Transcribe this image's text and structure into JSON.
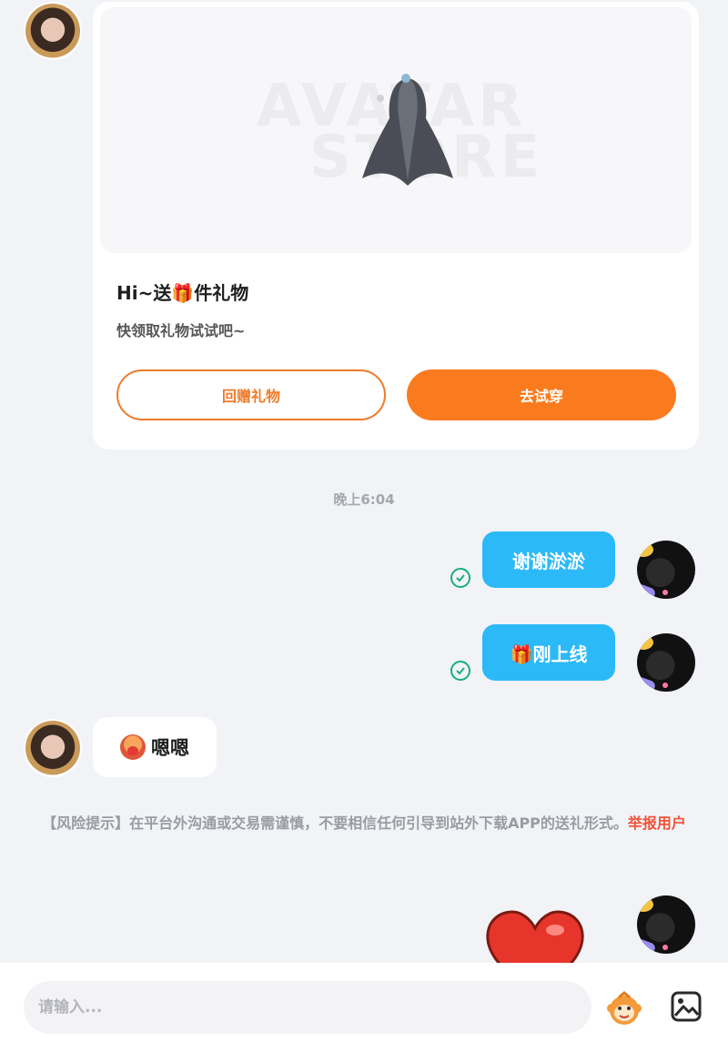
{
  "gift_card": {
    "watermark": [
      "AVATAR",
      "STORE"
    ],
    "title": "Hi~送🎁件礼物",
    "subtitle": "快领取礼物试试吧~",
    "return_button": "回赠礼物",
    "try_button": "去试穿"
  },
  "time_divider": "晚上6:04",
  "outgoing_messages": [
    {
      "text": "谢谢淤淤",
      "status": "read"
    },
    {
      "text": "🎁刚上线",
      "status": "read"
    }
  ],
  "incoming_message": {
    "text": "嗯嗯"
  },
  "risk_notice": {
    "text": "【风险提示】在平台外沟通或交易需谨慎，不要相信任何引导到站外下载APP的送礼形式。",
    "link": "举报用户"
  },
  "input": {
    "placeholder": "请输入..."
  },
  "icons": {
    "sticker": "monkey-sticker-icon",
    "image": "image-icon",
    "read_check": "check-circle-icon"
  },
  "colors": {
    "accent_orange": "#fa7a1e",
    "outgoing_bubble": "#2cb9f8",
    "check_green": "#18b07a",
    "report_red": "#f0543a"
  }
}
